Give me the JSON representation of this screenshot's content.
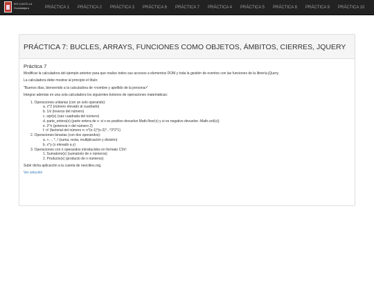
{
  "brand": {
    "line1": "IES CASTILLA",
    "line2": "Guadalajara"
  },
  "nav": [
    "PRÁCTICA 1",
    "PRÁCTICA 2",
    "PRÁCTICA 3",
    "PRÁCTICA 6",
    "PRÁCTICA 7",
    "PRÁCTICA 4",
    "PRÁCTICA 5",
    "PRÁCTICA 8",
    "PRÁCTICA 9",
    "PRÁCTICA 10"
  ],
  "panel": {
    "heading": "PRÁCTICA 7: BUCLES, ARRAYS, FUNCIONES COMO OBJETOS, ÁMBITOS, CIERRES, JQUERY",
    "subtitle": "Práctica 7",
    "p1": "Modificar la calculadora del ejemplo anterior para que realice todos sus accesos a elementos DOM y toda la gestión de eventos con las funciones de la librería jQuery.",
    "p2": "La calculadora debe mostrar al principio el título:",
    "p3": "\"Buenos días, bienvenido a la calculadora de <nombre y apellido de la persona>\"",
    "p4": "Integrar además en una sola calculadora los siguientes botones de operaciones matemáticas:",
    "list": [
      {
        "label": "1. Operaciones unitarias (con un solo operando):",
        "items": [
          "a. x^2 (número elevado al cuadrado)",
          "b. 1/x (inverso del número)",
          "c. sqrt(x) (raíz cuadrada del número)",
          "d. parte_entera(x) (parte entera de x: si x es positivo devuelve Math.floor(x) y si es negativo devuelve -Math.ceil(x))",
          "e. 2^n (potencia n del número 2)",
          "f. n! (factorial del número n: n*(n-1)*(n-2)*...*3*2*1)"
        ]
      },
      {
        "label": "2. Operaciones binarias (con dos operandos):",
        "items": [
          "a. +, -, *, / (suma, resta, multiplicación y división)",
          "b. x^y (x elevado a y)"
        ]
      },
      {
        "label": "3. Operaciones con n operandos introducidos en formato CSV:",
        "items": [
          "1. Sumatorio(x) (sumatorio de n números)",
          "2. Producto(x) (producto de n números)"
        ]
      }
    ],
    "p5": "Subir dicha aplicación a la cuenta de neocities.org.",
    "link": "Ver solución"
  }
}
